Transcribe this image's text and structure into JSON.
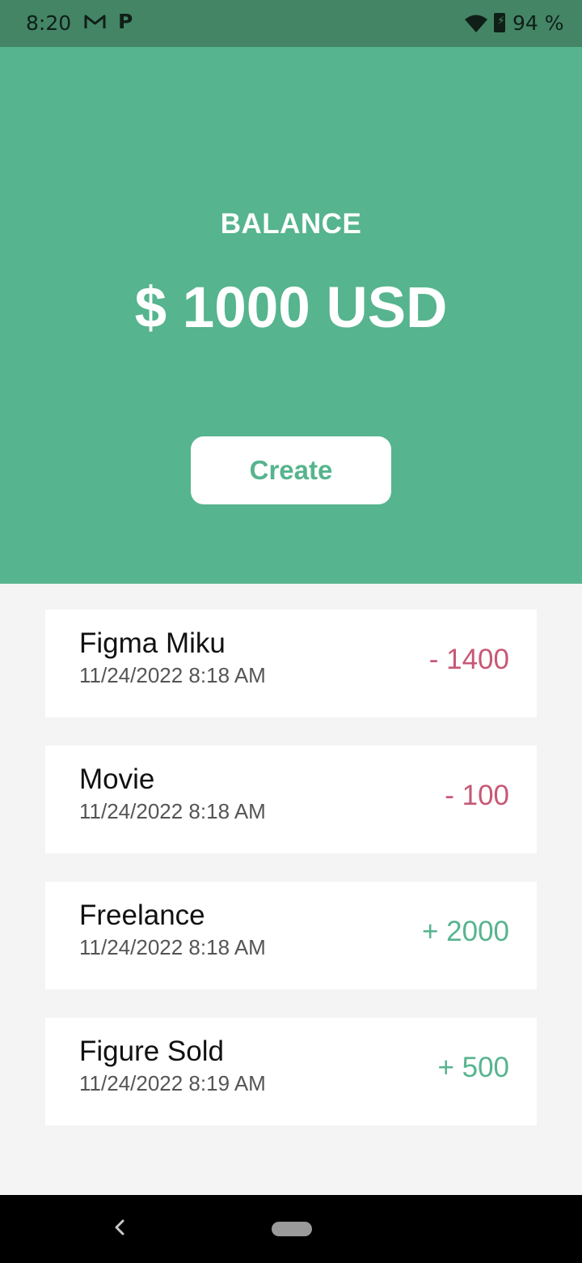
{
  "status_bar": {
    "time": "8:20",
    "battery_pct": "94 %",
    "notification_icons": [
      "gmail-icon",
      "paypal-icon"
    ],
    "system_icons": [
      "wifi-icon",
      "battery-icon"
    ]
  },
  "header": {
    "balance_label": "BALANCE",
    "balance_amount": "$ 1000 USD",
    "create_label": "Create"
  },
  "transactions": [
    {
      "name": "Figma Miku",
      "date": "11/24/2022 8:18 AM",
      "amount": "- 1400",
      "type": "expense"
    },
    {
      "name": "Movie",
      "date": "11/24/2022 8:18 AM",
      "amount": "- 100",
      "type": "expense"
    },
    {
      "name": "Freelance",
      "date": "11/24/2022 8:18 AM",
      "amount": "+ 2000",
      "type": "income"
    },
    {
      "name": "Figure Sold",
      "date": "11/24/2022 8:19 AM",
      "amount": "+ 500",
      "type": "income"
    }
  ],
  "colors": {
    "accent": "#56b48e",
    "status_bar": "#448566",
    "expense": "#c75876",
    "income": "#56b48e",
    "background": "#f4f4f4"
  }
}
